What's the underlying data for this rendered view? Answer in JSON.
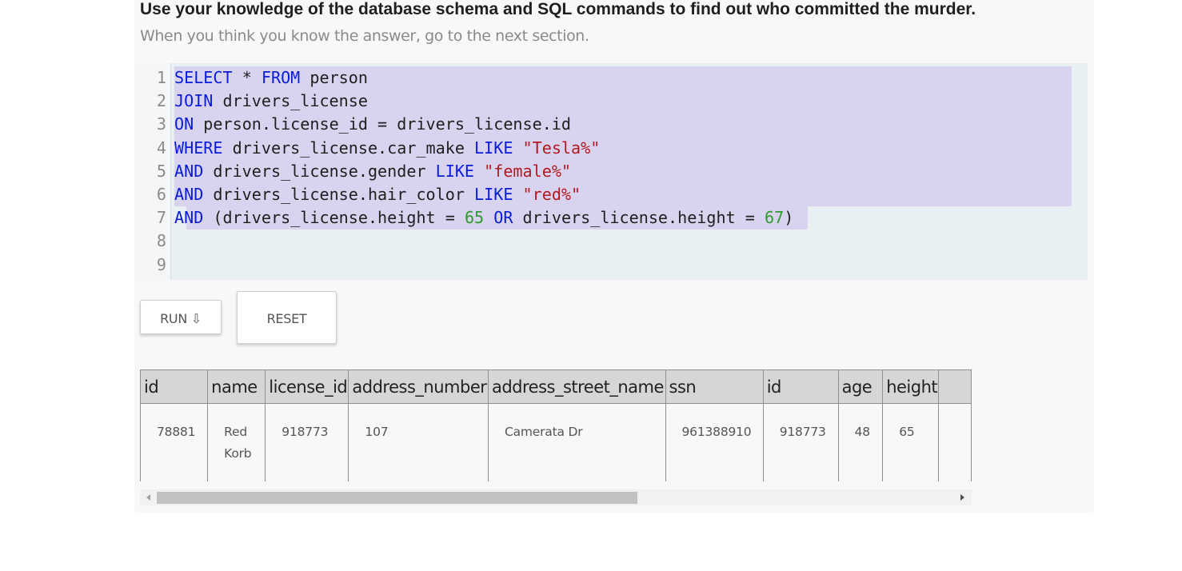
{
  "heading": "Use your knowledge of the database schema and SQL commands to find out who committed the murder.",
  "subheading": "When you think you know the answer, go to the next section.",
  "editor": {
    "lines": [
      {
        "num": "1",
        "tokens": [
          {
            "t": "kw",
            "v": "SELECT"
          },
          {
            "t": "",
            "v": " * "
          },
          {
            "t": "kw",
            "v": "FROM"
          },
          {
            "t": "",
            "v": " person"
          }
        ]
      },
      {
        "num": "2",
        "tokens": [
          {
            "t": "kw",
            "v": "JOIN"
          },
          {
            "t": "",
            "v": " drivers_license"
          }
        ]
      },
      {
        "num": "3",
        "tokens": [
          {
            "t": "kw",
            "v": "ON"
          },
          {
            "t": "",
            "v": " person.license_id = drivers_license.id"
          }
        ]
      },
      {
        "num": "4",
        "tokens": [
          {
            "t": "kw",
            "v": "WHERE"
          },
          {
            "t": "",
            "v": " drivers_license.car_make "
          },
          {
            "t": "kw",
            "v": "LIKE"
          },
          {
            "t": "",
            "v": " "
          },
          {
            "t": "str",
            "v": "\"Tesla%\""
          }
        ]
      },
      {
        "num": "5",
        "tokens": [
          {
            "t": "kw",
            "v": "AND"
          },
          {
            "t": "",
            "v": " drivers_license.gender "
          },
          {
            "t": "kw",
            "v": "LIKE"
          },
          {
            "t": "",
            "v": " "
          },
          {
            "t": "str",
            "v": "\"female%\""
          }
        ]
      },
      {
        "num": "6",
        "tokens": [
          {
            "t": "kw",
            "v": "AND"
          },
          {
            "t": "",
            "v": " drivers_license.hair_color "
          },
          {
            "t": "kw",
            "v": "LIKE"
          },
          {
            "t": "",
            "v": " "
          },
          {
            "t": "str",
            "v": "\"red%\""
          }
        ]
      },
      {
        "num": "7",
        "tokens": [
          {
            "t": "kw",
            "v": "AND"
          },
          {
            "t": "",
            "v": " (drivers_license.height = "
          },
          {
            "t": "num",
            "v": "65"
          },
          {
            "t": "",
            "v": " "
          },
          {
            "t": "kw",
            "v": "OR"
          },
          {
            "t": "",
            "v": " drivers_license.height = "
          },
          {
            "t": "num",
            "v": "67"
          },
          {
            "t": "",
            "v": ")"
          }
        ]
      },
      {
        "num": "8",
        "tokens": []
      },
      {
        "num": "9",
        "tokens": []
      }
    ]
  },
  "buttons": {
    "run_label": "RUN ⇩",
    "reset_label": "RESET"
  },
  "results": {
    "columns": [
      "id",
      "name",
      "license_id",
      "address_number",
      "address_street_name",
      "ssn",
      "id",
      "age",
      "height"
    ],
    "rows": [
      [
        "78881",
        "Red Korb",
        "918773",
        "107",
        "Camerata Dr",
        "961388910",
        "918773",
        "48",
        "65"
      ]
    ]
  },
  "colors": {
    "keyword": "#0b1cd9",
    "string": "#b3191f",
    "number": "#2e9a2e",
    "selection": "#d8d4ef",
    "editor_bg": "#e9f0f3"
  }
}
